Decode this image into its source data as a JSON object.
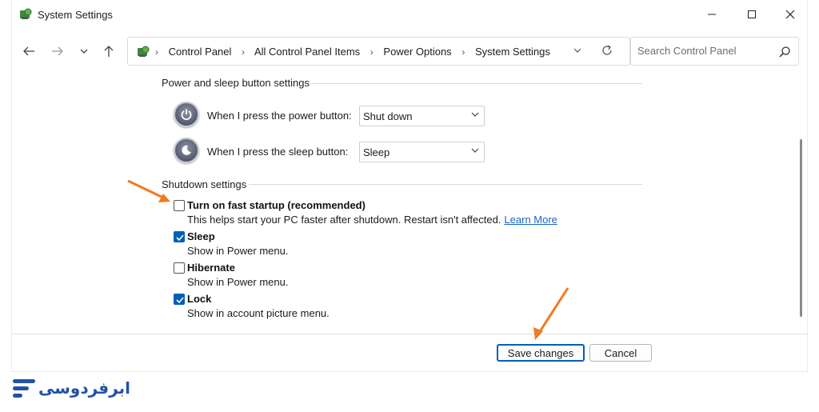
{
  "window": {
    "title": "System Settings",
    "controls": {
      "minimize": "—",
      "maximize": "☐",
      "close": "✕"
    }
  },
  "nav": {
    "back_icon": "arrow-left-icon",
    "forward_icon": "arrow-right-icon",
    "recent_icon": "chevron-down-icon",
    "up_icon": "arrow-up-icon"
  },
  "address": {
    "crumbs": [
      "Control Panel",
      "All Control Panel Items",
      "Power Options",
      "System Settings"
    ],
    "separator": "›"
  },
  "search": {
    "placeholder": "Search Control Panel"
  },
  "power_buttons": {
    "heading": "Power and sleep button settings",
    "power_label": "When I press the power button:",
    "power_value": "Shut down",
    "sleep_label": "When I press the sleep button:",
    "sleep_value": "Sleep"
  },
  "shutdown": {
    "heading": "Shutdown settings",
    "items": [
      {
        "title": "Turn on fast startup (recommended)",
        "desc": "This helps start your PC faster after shutdown. Restart isn't affected.",
        "link": "Learn More",
        "checked": false
      },
      {
        "title": "Sleep",
        "desc": "Show in Power menu.",
        "checked": true
      },
      {
        "title": "Hibernate",
        "desc": "Show in Power menu.",
        "checked": false
      },
      {
        "title": "Lock",
        "desc": "Show in account picture menu.",
        "checked": true
      }
    ]
  },
  "footer": {
    "save": "Save changes",
    "cancel": "Cancel"
  },
  "watermark": {
    "text": "ابرفردوسی"
  },
  "colors": {
    "accent": "#005fb8",
    "link": "#1967c9",
    "annotation_arrow": "#f07a22",
    "watermark": "#2152a6"
  }
}
